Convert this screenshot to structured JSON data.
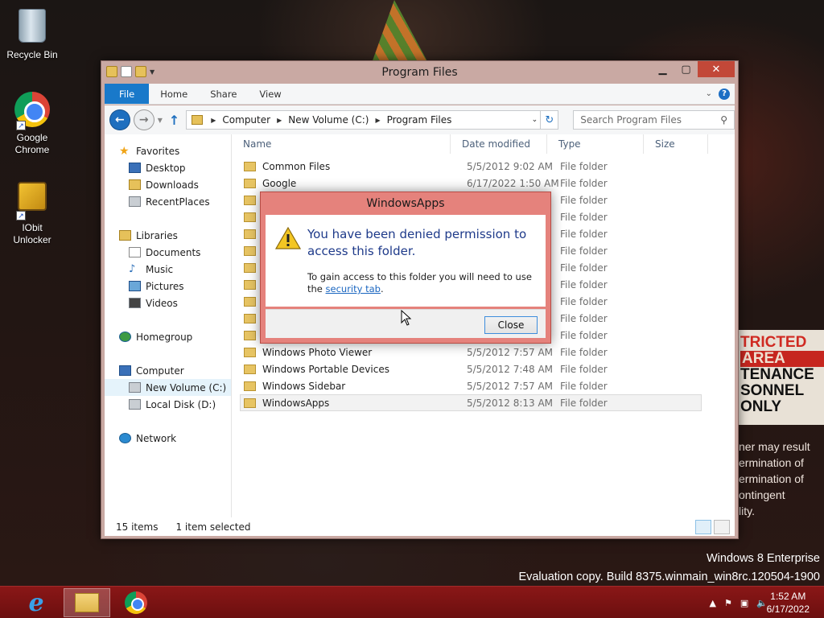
{
  "desktop": {
    "icons": [
      {
        "label": "Recycle Bin"
      },
      {
        "label": "Google Chrome"
      },
      {
        "label": "IObit Unlocker"
      }
    ],
    "sign_lines": [
      "TRICTED",
      "AREA",
      "TENANCE",
      "SONNEL",
      "ONLY"
    ],
    "warning_lines": [
      "ner may result",
      "ermination of",
      "ermination of",
      "ontingent",
      "lity."
    ],
    "watermark": {
      "edition": "Windows 8 Enterprise",
      "build": "Evaluation copy. Build 8375.winmain_win8rc.120504-1900"
    }
  },
  "explorer": {
    "title": "Program Files",
    "ribbon_tabs": [
      "File",
      "Home",
      "Share",
      "View"
    ],
    "address": {
      "crumbs": [
        "Computer",
        "New Volume (C:)",
        "Program Files"
      ]
    },
    "search_placeholder": "Search Program Files",
    "nav": {
      "favorites": {
        "label": "Favorites",
        "items": [
          "Desktop",
          "Downloads",
          "RecentPlaces"
        ]
      },
      "libraries": {
        "label": "Libraries",
        "items": [
          "Documents",
          "Music",
          "Pictures",
          "Videos"
        ]
      },
      "homegroup": "Homegroup",
      "computer": {
        "label": "Computer",
        "items": [
          "New Volume (C:)",
          "Local Disk (D:)"
        ]
      },
      "network": "Network"
    },
    "columns": [
      "Name",
      "Date modified",
      "Type",
      "Size"
    ],
    "rows": [
      {
        "name": "Common Files",
        "date": "5/5/2012 9:02 AM",
        "type": "File folder"
      },
      {
        "name": "Google",
        "date": "6/17/2022 1:50 AM",
        "type": "File folder"
      },
      {
        "name": "",
        "date": "",
        "type": "File folder"
      },
      {
        "name": "",
        "date": "",
        "type": "File folder"
      },
      {
        "name": "",
        "date": "",
        "type": "File folder"
      },
      {
        "name": "",
        "date": "",
        "type": "File folder"
      },
      {
        "name": "",
        "date": "",
        "type": "File folder"
      },
      {
        "name": "",
        "date": "",
        "type": "File folder"
      },
      {
        "name": "",
        "date": "",
        "type": "File folder"
      },
      {
        "name": "",
        "date": "",
        "type": "File folder"
      },
      {
        "name": "",
        "date": "",
        "type": "File folder"
      },
      {
        "name": "Windows Photo Viewer",
        "date": "5/5/2012 7:57 AM",
        "type": "File folder"
      },
      {
        "name": "Windows Portable Devices",
        "date": "5/5/2012 7:48 AM",
        "type": "File folder"
      },
      {
        "name": "Windows Sidebar",
        "date": "5/5/2012 7:57 AM",
        "type": "File folder"
      },
      {
        "name": "WindowsApps",
        "date": "5/5/2012 8:13 AM",
        "type": "File folder"
      }
    ],
    "status": {
      "count": "15 items",
      "selection": "1 item selected"
    }
  },
  "dialog": {
    "title": "WindowsApps",
    "message": "You have been denied permission to access this folder.",
    "detail_prefix": "To gain access to this folder you will need to use the",
    "detail_link": "security tab",
    "detail_suffix": ".",
    "close_label": "Close"
  },
  "taskbar": {
    "time": "1:52 AM",
    "date": "6/17/2022"
  },
  "colors": {
    "accent": "#1979ca",
    "window_frame": "#c9a9a3",
    "dialog_frame": "#e5827c",
    "taskbar": "#7a1313"
  }
}
